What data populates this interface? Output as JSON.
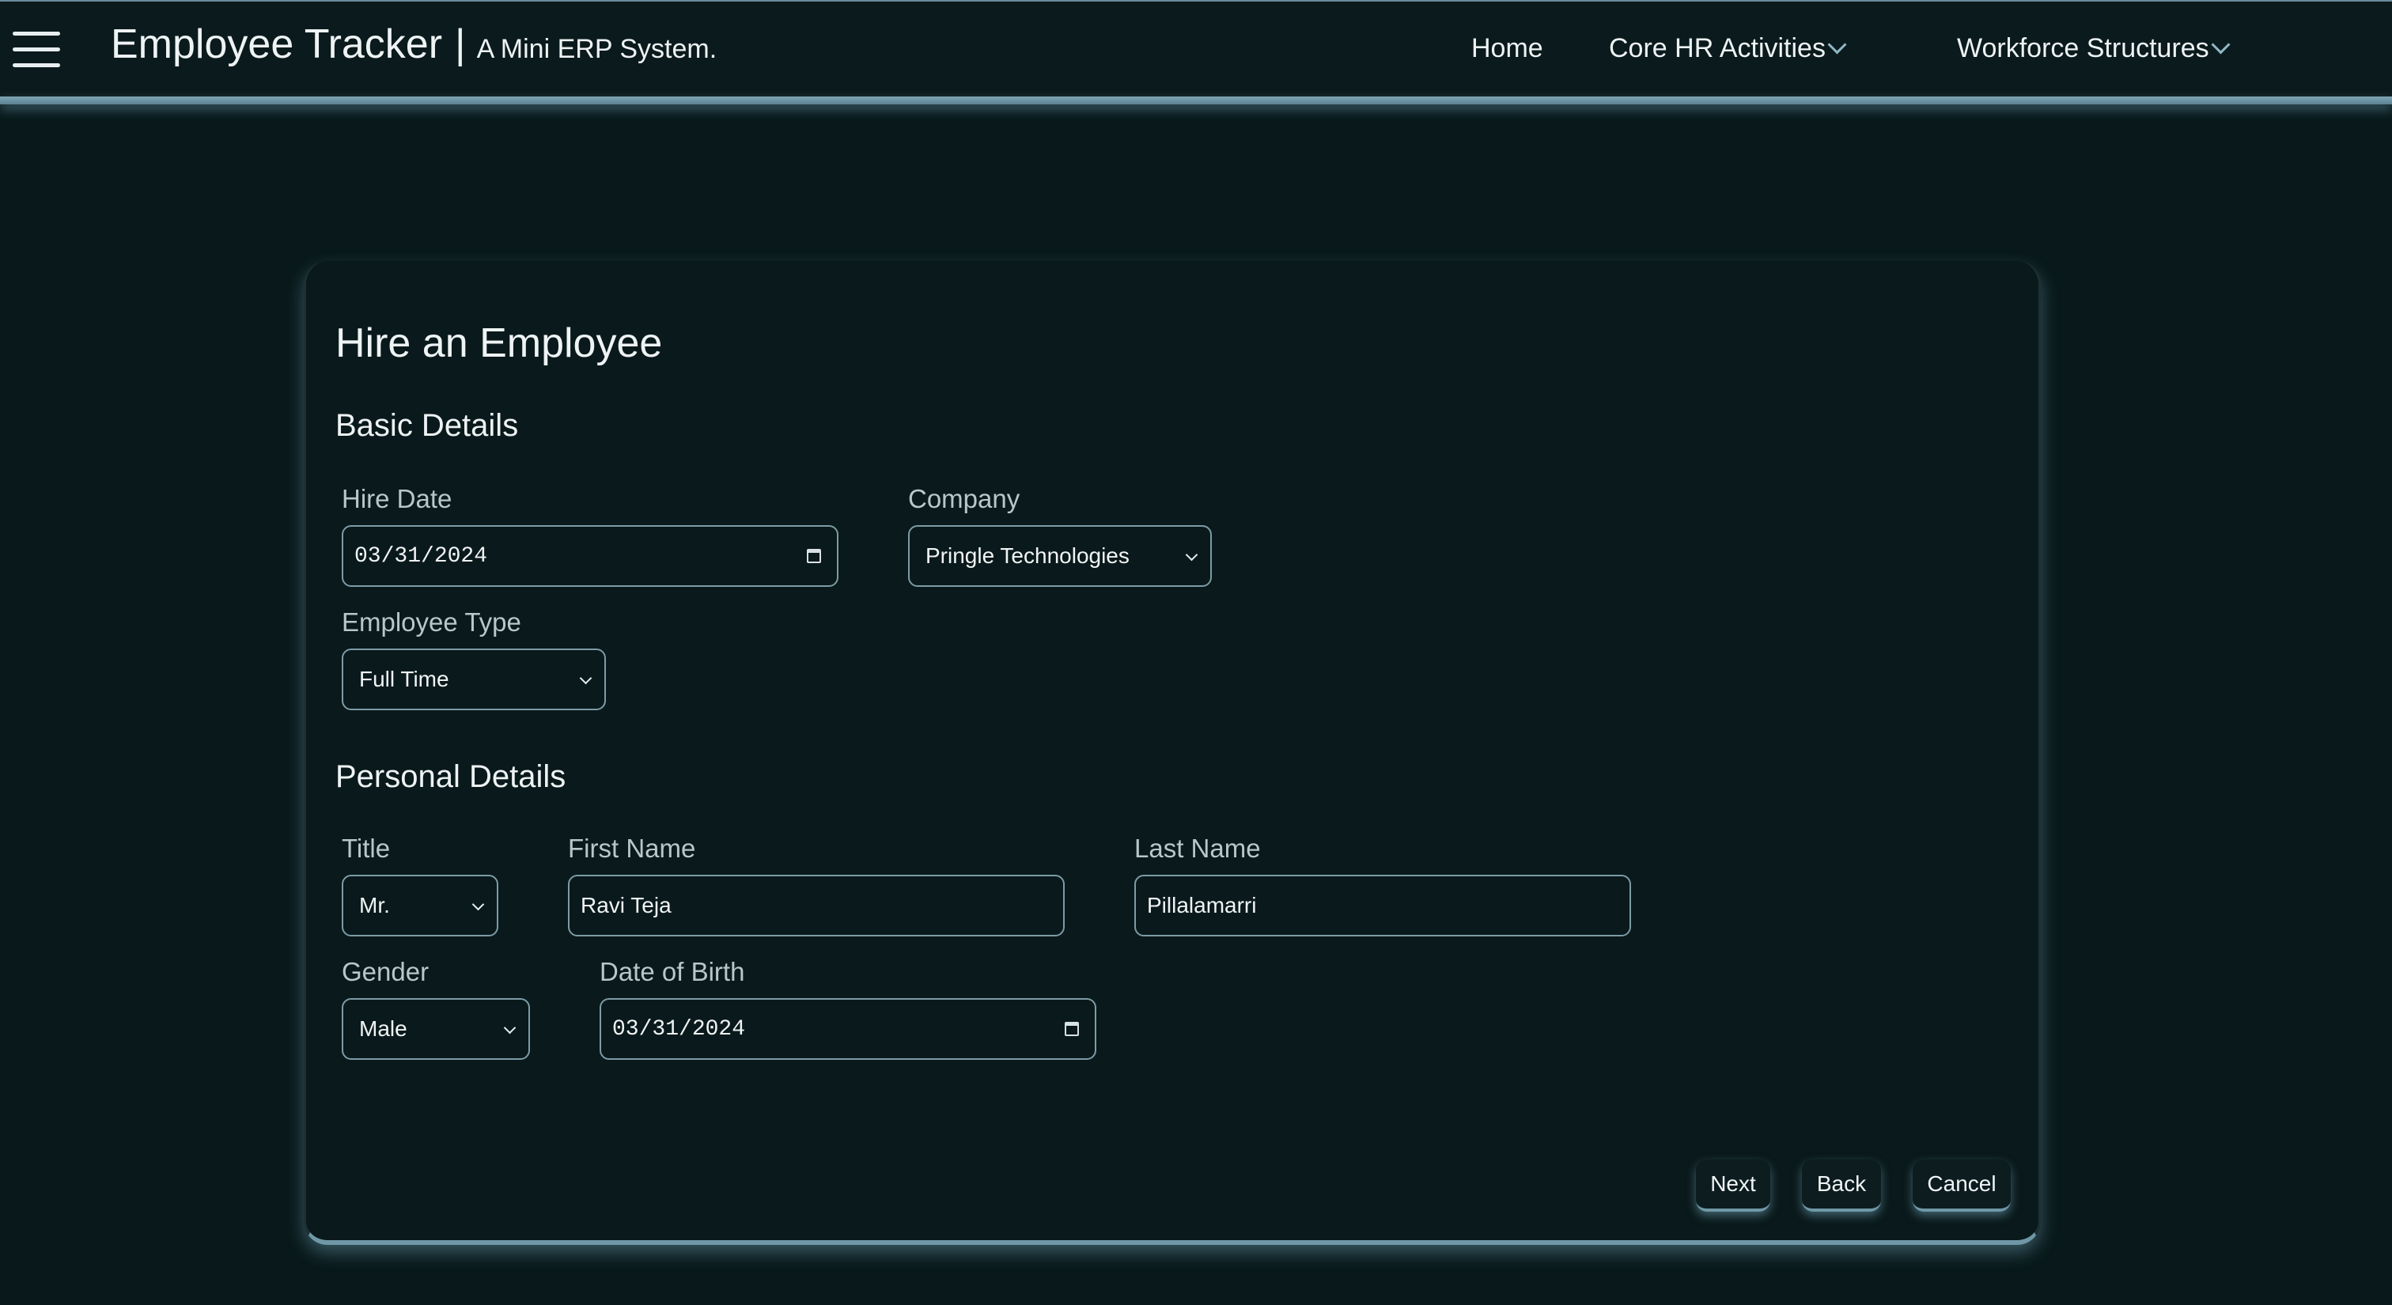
{
  "header": {
    "brand_title": "Employee Tracker",
    "brand_separator": "|",
    "brand_subtitle": "A Mini ERP System.",
    "menu_icon": "hamburger-menu-icon",
    "nav": {
      "home": "Home",
      "core_hr": "Core HR Activities",
      "workforce": "Workforce Structures"
    }
  },
  "form": {
    "title": "Hire an Employee",
    "basic_details": {
      "heading": "Basic Details",
      "hire_date_label": "Hire Date",
      "hire_date_value": "03/31/2024",
      "company_label": "Company",
      "company_value": "Pringle Technologies",
      "employee_type_label": "Employee Type",
      "employee_type_value": "Full Time"
    },
    "personal_details": {
      "heading": "Personal Details",
      "title_label": "Title",
      "title_value": "Mr.",
      "first_name_label": "First Name",
      "first_name_value": "Ravi Teja",
      "last_name_label": "Last Name",
      "last_name_value": "Pillalamarri",
      "gender_label": "Gender",
      "gender_value": "Male",
      "dob_label": "Date of Birth",
      "dob_value": "03/31/2024"
    },
    "buttons": {
      "next": "Next",
      "back": "Back",
      "cancel": "Cancel"
    }
  },
  "colors": {
    "background": "#09191b",
    "accent": "#6f97a6",
    "text": "#eef3f4"
  }
}
